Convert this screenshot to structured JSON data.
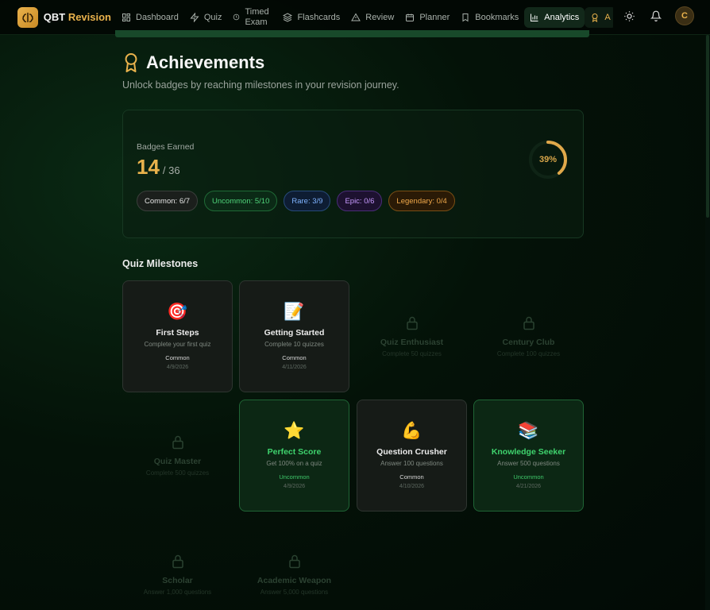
{
  "brand": {
    "name_part1": "QBT",
    "name_part2": "Revision",
    "logo_icon": "brain-icon",
    "accent": "#e9b24c"
  },
  "nav": {
    "items": [
      {
        "label": "Dashboard",
        "icon": "dashboard-icon"
      },
      {
        "label": "Quiz",
        "icon": "lightning-icon"
      },
      {
        "label": "Timed Exam",
        "icon": "clock-icon"
      },
      {
        "label": "Flashcards",
        "icon": "layers-icon"
      },
      {
        "label": "Review",
        "icon": "warning-icon"
      },
      {
        "label": "Planner",
        "icon": "calendar-icon"
      },
      {
        "label": "Bookmarks",
        "icon": "bookmark-icon"
      },
      {
        "label": "Analytics",
        "icon": "bar-chart-icon",
        "active": true
      },
      {
        "label": "A",
        "icon": "award-icon"
      }
    ],
    "avatar_initial": "C"
  },
  "page": {
    "title": "Achievements",
    "subtitle": "Unlock badges by reaching milestones in your revision journey."
  },
  "summary": {
    "label": "Badges Earned",
    "earned": "14",
    "total": "/ 36",
    "progress_percent": 39,
    "progress_label": "39%",
    "pills": [
      {
        "label": "Common: 6/7",
        "tier": "common"
      },
      {
        "label": "Uncommon: 5/10",
        "tier": "uncommon"
      },
      {
        "label": "Rare: 3/9",
        "tier": "rare"
      },
      {
        "label": "Epic: 0/6",
        "tier": "epic"
      },
      {
        "label": "Legendary: 0/4",
        "tier": "legendary"
      }
    ]
  },
  "section": {
    "title": "Quiz Milestones"
  },
  "badges": [
    {
      "emoji": "🎯",
      "name": "First Steps",
      "desc": "Complete your first quiz",
      "rarity": "Common",
      "date": "4/9/2026",
      "state": "common"
    },
    {
      "emoji": "📝",
      "name": "Getting Started",
      "desc": "Complete 10 quizzes",
      "rarity": "Common",
      "date": "4/11/2026",
      "state": "common"
    },
    {
      "name": "Quiz Enthusiast",
      "desc": "Complete 50 quizzes",
      "state": "locked"
    },
    {
      "name": "Century Club",
      "desc": "Complete 100 quizzes",
      "state": "locked"
    },
    {
      "name": "Quiz Master",
      "desc": "Complete 500 quizzes",
      "state": "locked"
    },
    {
      "emoji": "⭐",
      "name": "Perfect Score",
      "desc": "Get 100% on a quiz",
      "rarity": "Uncommon",
      "date": "4/9/2026",
      "state": "uncommon"
    },
    {
      "emoji": "💪",
      "name": "Question Crusher",
      "desc": "Answer 100 questions",
      "rarity": "Common",
      "date": "4/10/2026",
      "state": "common"
    },
    {
      "emoji": "📚",
      "name": "Knowledge Seeker",
      "desc": "Answer 500 questions",
      "rarity": "Uncommon",
      "date": "4/21/2026",
      "state": "uncommon"
    },
    {
      "name": "Scholar",
      "desc": "Answer 1,000 questions",
      "state": "locked"
    },
    {
      "name": "Academic Weapon",
      "desc": "Answer 5,000 questions",
      "state": "locked"
    }
  ]
}
